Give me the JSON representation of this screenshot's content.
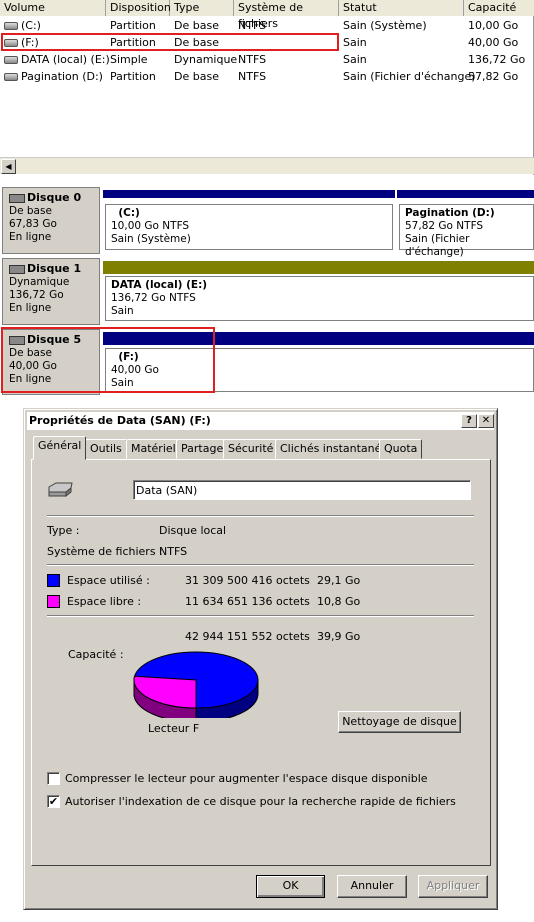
{
  "volume_list": {
    "columns": [
      "Volume",
      "Disposition",
      "Type",
      "Système de fichiers",
      "Statut",
      "Capacité"
    ],
    "rows": [
      {
        "volume": "(C:)",
        "disposition": "Partition",
        "type": "De base",
        "fs": "NTFS",
        "status": "Sain (Système)",
        "capacity": "10,00 Go"
      },
      {
        "volume": "(F:)",
        "disposition": "Partition",
        "type": "De base",
        "fs": "",
        "status": "Sain",
        "capacity": "40,00 Go"
      },
      {
        "volume": "DATA (local) (E:)",
        "disposition": "Simple",
        "type": "Dynamique",
        "fs": "NTFS",
        "status": "Sain",
        "capacity": "136,72 Go"
      },
      {
        "volume": "Pagination (D:)",
        "disposition": "Partition",
        "type": "De base",
        "fs": "NTFS",
        "status": "Sain (Fichier d'échange)",
        "capacity": "57,82 Go"
      }
    ]
  },
  "disks": {
    "d0": {
      "name": "Disque 0",
      "type": "De base",
      "size": "67,83 Go",
      "state": "En ligne"
    },
    "d0p1": {
      "name": "(C:)",
      "detail": "10,00 Go NTFS",
      "status": "Sain (Système)"
    },
    "d0p2": {
      "name": "Pagination  (D:)",
      "detail": "57,82 Go NTFS",
      "status": "Sain (Fichier d'échange)"
    },
    "d1": {
      "name": "Disque 1",
      "type": "Dynamique",
      "size": "136,72 Go",
      "state": "En ligne"
    },
    "d1p1": {
      "name": "DATA (local)  (E:)",
      "detail": "136,72 Go NTFS",
      "status": "Sain"
    },
    "d5": {
      "name": "Disque 5",
      "type": "De base",
      "size": "40,00 Go",
      "state": "En ligne"
    },
    "d5p1": {
      "name": "(F:)",
      "detail": "40,00 Go",
      "status": "Sain"
    }
  },
  "dialog": {
    "title": "Propriétés de Data (SAN) (F:)",
    "help_btn": "?",
    "close_btn": "✕",
    "tabs": [
      "Général",
      "Outils",
      "Matériel",
      "Partage",
      "Sécurité",
      "Clichés instantanés",
      "Quota"
    ],
    "volume_name": "Data (SAN)",
    "type_label": "Type :",
    "type_value": "Disque local",
    "fs_label": "Système de fichiers :",
    "fs_value": "NTFS",
    "used_label": "Espace utilisé :",
    "used_bytes": "31 309 500 416 octets",
    "used_go": "29,1 Go",
    "free_label": "Espace libre :",
    "free_bytes": "11 634 651 136 octets",
    "free_go": "10,8 Go",
    "capacity_label": "Capacité :",
    "capacity_bytes": "42 944 151 552 octets",
    "capacity_go": "39,9 Go",
    "drive_label": "Lecteur F",
    "cleanup_btn": "Nettoyage de disque",
    "compress_label": "Compresser le lecteur pour augmenter l'espace disque disponible",
    "compress_checked": false,
    "index_label": "Autoriser l'indexation de ce disque pour la recherche rapide de fichiers",
    "index_checked": true,
    "ok_btn": "OK",
    "cancel_btn": "Annuler",
    "apply_btn": "Appliquer",
    "used_fraction": 0.729,
    "colors": {
      "used": "#0000ff",
      "free": "#ff00ff",
      "highlight": "#e02020",
      "partition_bar": "#000080",
      "dynamic_bar": "#808000"
    }
  }
}
